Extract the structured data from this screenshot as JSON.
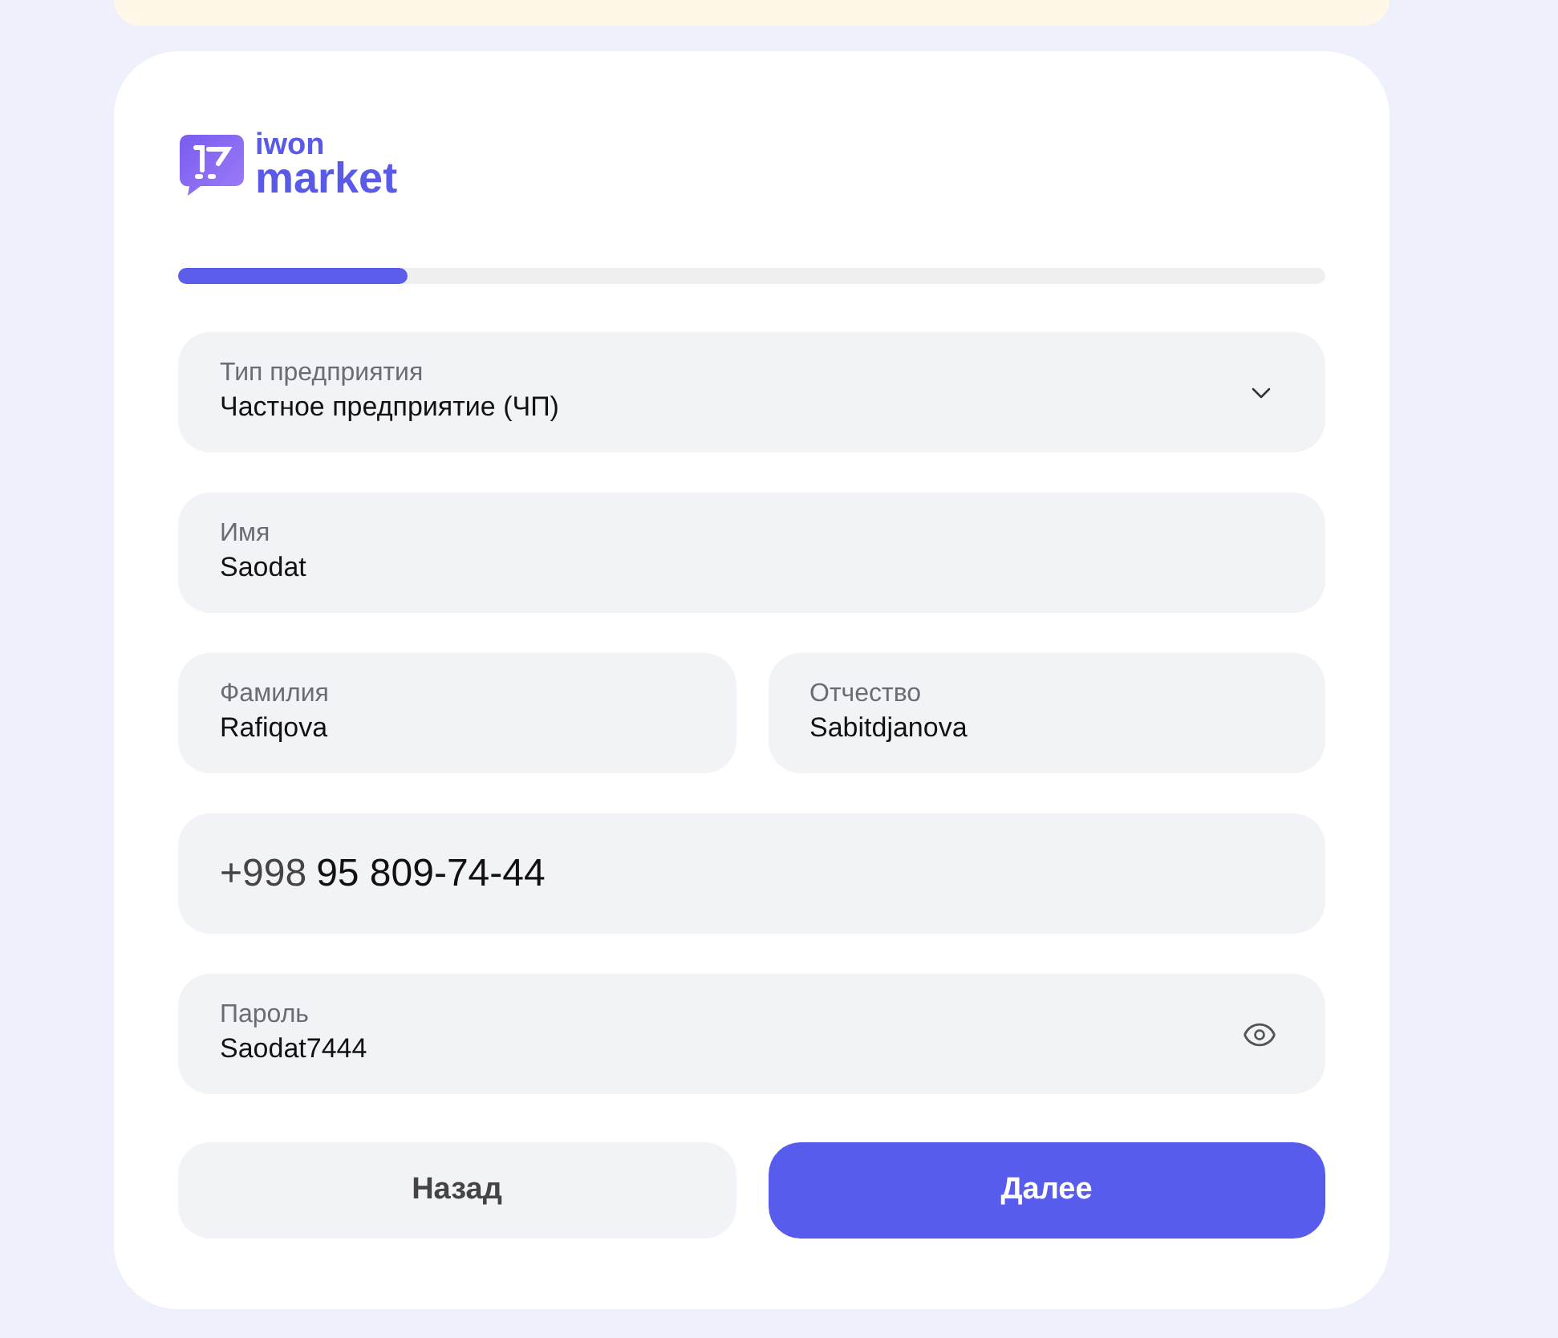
{
  "logo": {
    "line_1": "iwon",
    "line_2": "market"
  },
  "progress": {
    "level": 0.2
  },
  "fields": [
    {
      "kind": "select",
      "label": "Тип предприятия",
      "value": "Частное предприятие (ЧП)"
    },
    {
      "kind": "text",
      "label": "Имя",
      "value": "Saodat"
    }
  ],
  "name_row": [
    {
      "label": "Фамилия",
      "value": "Rafiqova"
    },
    {
      "label": "Отчество",
      "value": "Sabitdjanova"
    }
  ],
  "phone": {
    "prefix": "+998",
    "value": "95 809-74-44"
  },
  "password": {
    "label": "Пароль",
    "value": "Saodat7444"
  },
  "buttons": [
    {
      "kind": "secondary",
      "label": "Назад"
    },
    {
      "kind": "primary",
      "label": "Далее"
    }
  ]
}
